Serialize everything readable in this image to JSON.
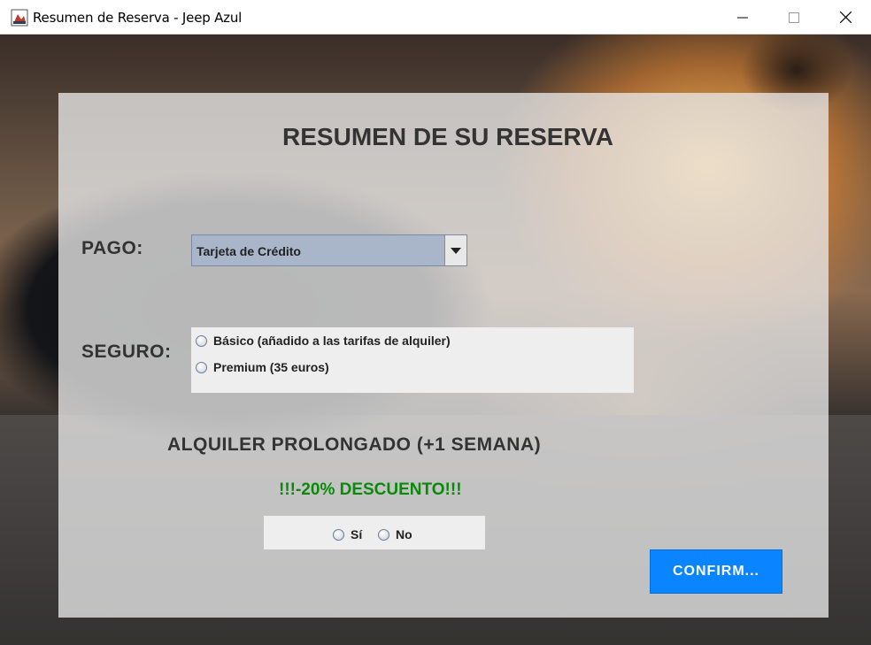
{
  "window": {
    "title": "Resumen de Reserva - Jeep Azul",
    "icon": "java-app-icon",
    "controls": [
      "minimize-icon",
      "maximize-icon",
      "close-icon"
    ]
  },
  "form": {
    "heading": "RESUMEN DE SU RESERVA",
    "pago": {
      "label": "PAGO:",
      "selected": "Tarjeta de Crédito"
    },
    "seguro": {
      "label": "SEGURO:",
      "options": [
        {
          "label": "Básico (añadido a las tarifas de alquiler)",
          "checked": false
        },
        {
          "label": "Premium (35 euros)",
          "checked": false
        }
      ]
    },
    "alquiler": {
      "title": "ALQUILER PROLONGADO (+1 SEMANA)",
      "descuento": "!!!-20% DESCUENTO!!!",
      "options": [
        {
          "label": "Sí",
          "checked": false
        },
        {
          "label": "No",
          "checked": false
        }
      ]
    },
    "confirm_label": "CONFIRM..."
  },
  "colors": {
    "confirm_button": "#0a84ff",
    "discount_text": "#0a8a0a",
    "combo_background": "#a9b6c9"
  }
}
